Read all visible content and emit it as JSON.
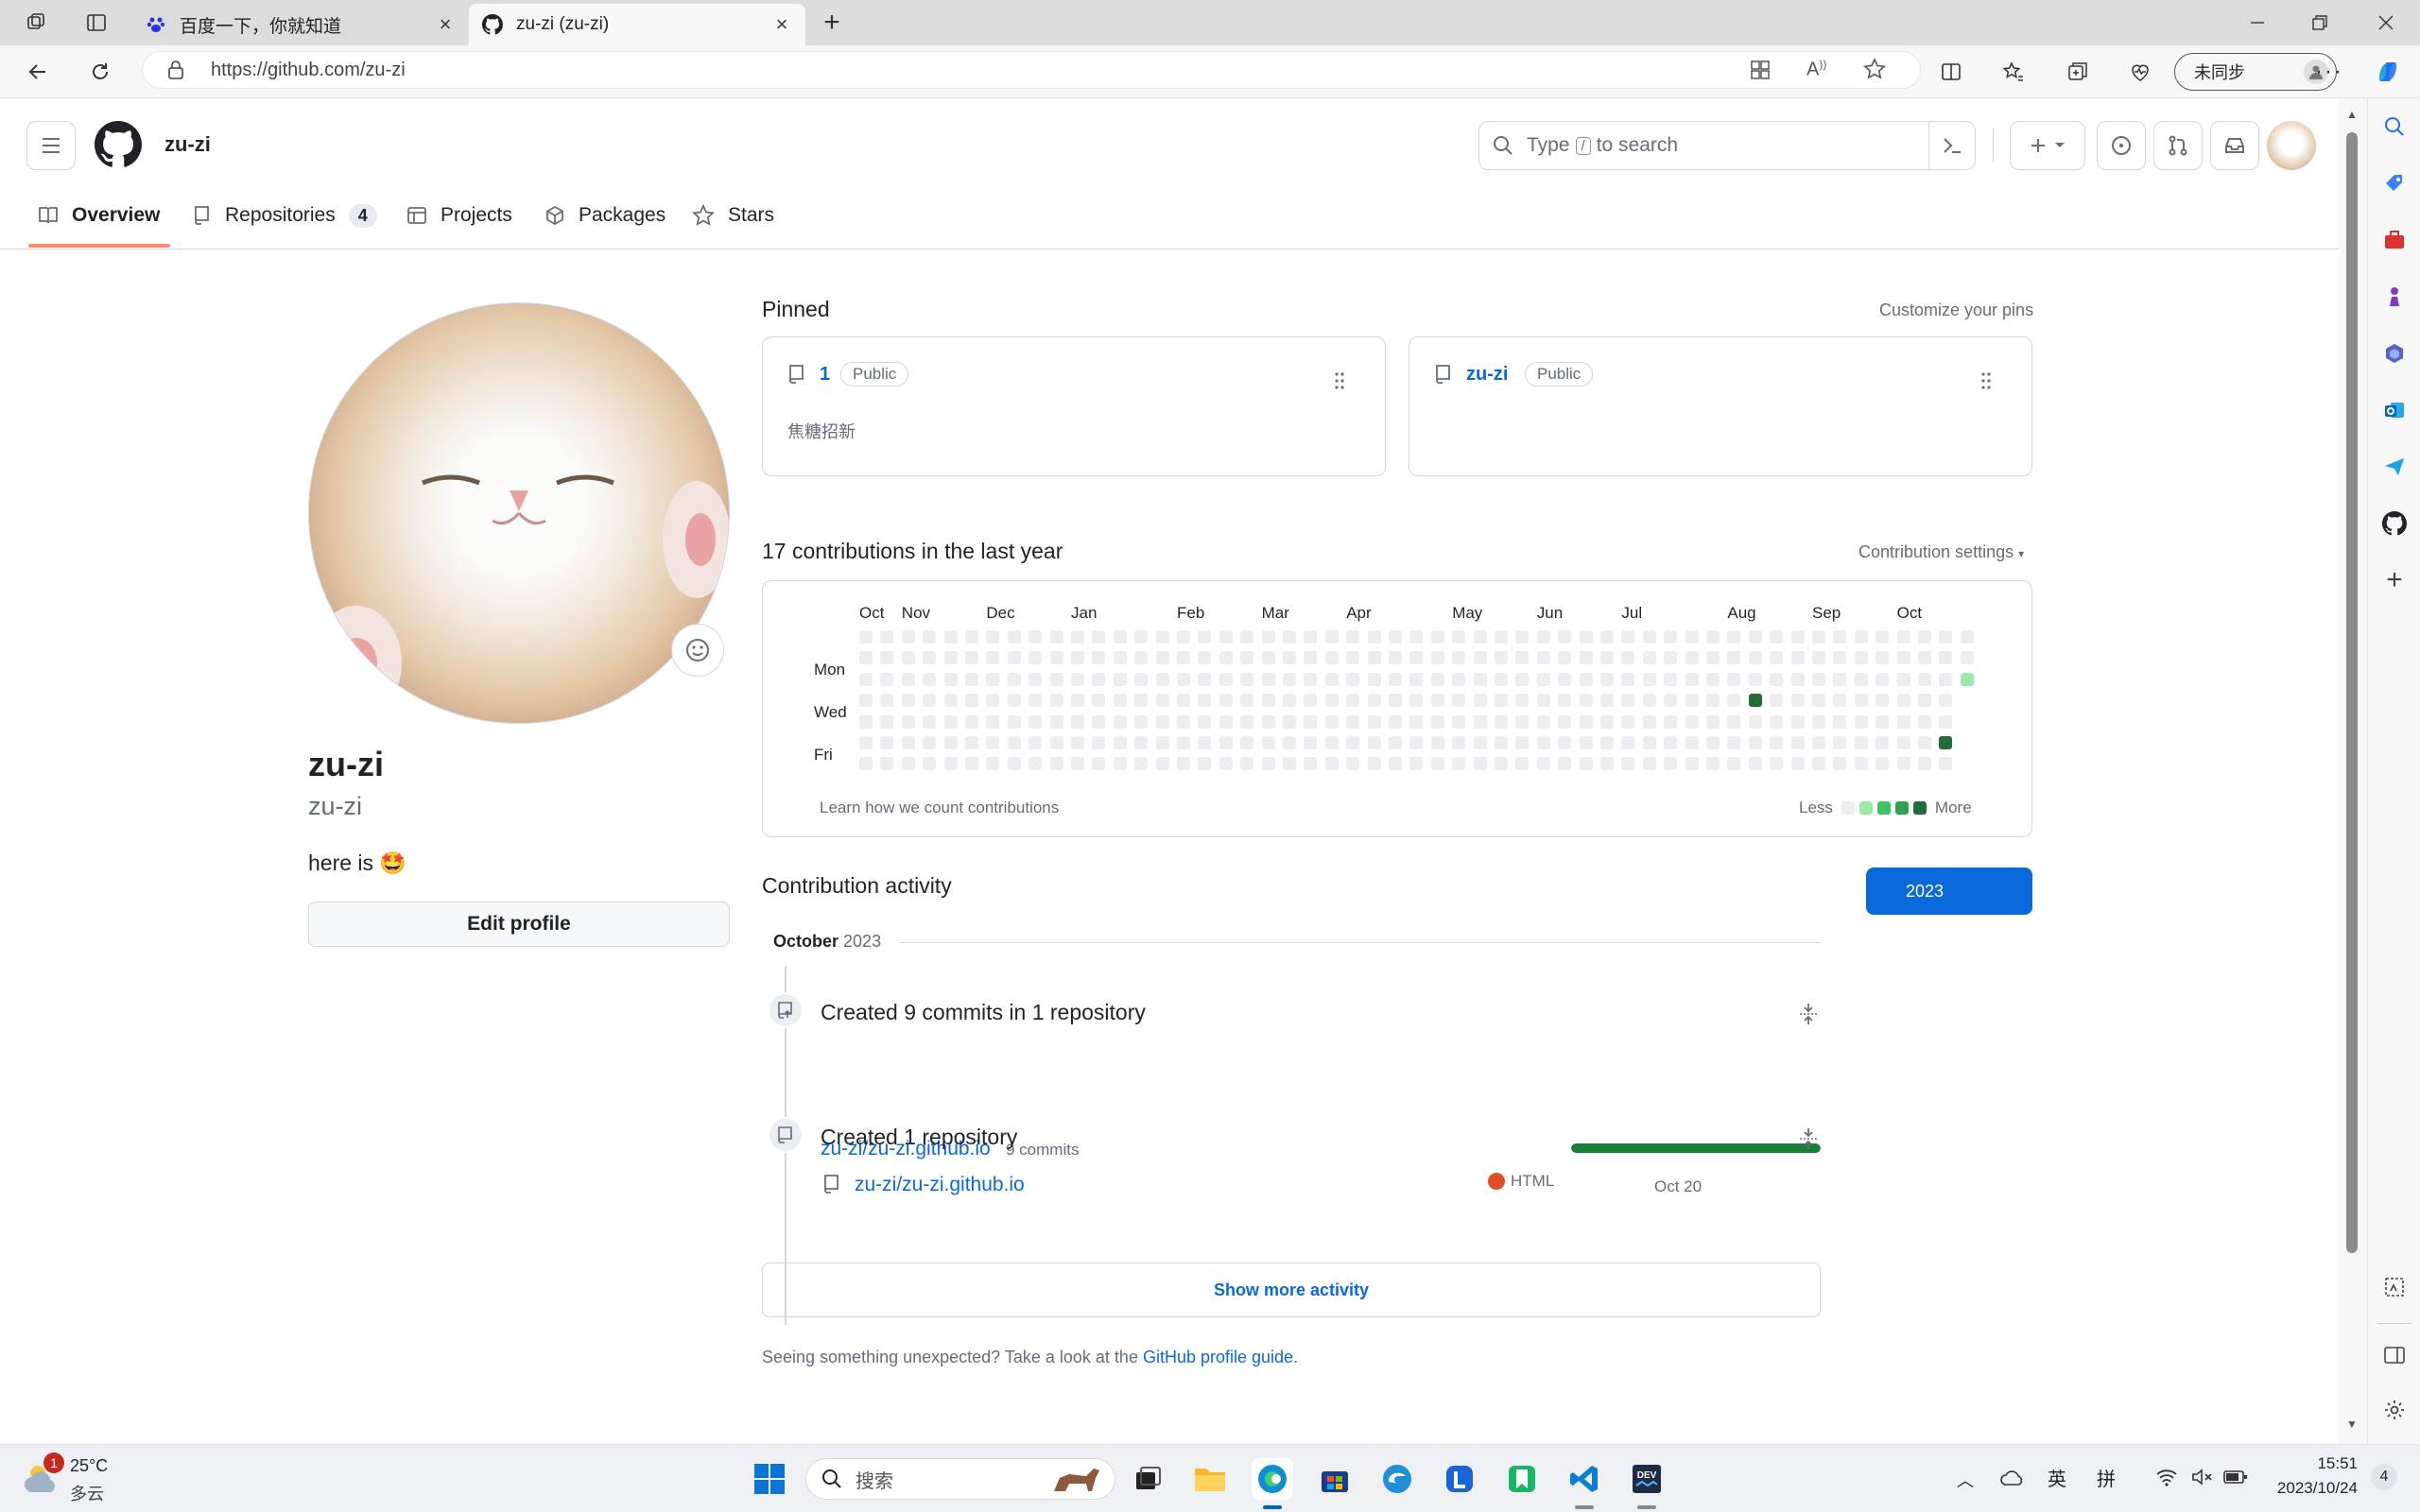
{
  "browser": {
    "tabs": [
      {
        "title": "百度一下，你就知道",
        "active": false
      },
      {
        "title": "zu-zi (zu-zi)",
        "active": true
      }
    ],
    "url": "https://github.com/zu-zi",
    "profile_label": "未同步"
  },
  "header": {
    "username": "zu-zi",
    "search_placeholder_pre": "Type",
    "search_key": "/",
    "search_placeholder_post": "to search"
  },
  "nav": {
    "tabs": [
      {
        "label": "Overview"
      },
      {
        "label": "Repositories",
        "count": "4"
      },
      {
        "label": "Projects"
      },
      {
        "label": "Packages"
      },
      {
        "label": "Stars"
      }
    ]
  },
  "profile": {
    "name": "zu-zi",
    "login": "zu-zi",
    "bio": "here is 🤩",
    "edit_button": "Edit profile"
  },
  "pinned": {
    "title": "Pinned",
    "customize": "Customize your pins",
    "items": [
      {
        "name": "1",
        "visibility": "Public",
        "description": "焦糖招新"
      },
      {
        "name": "zu-zi",
        "visibility": "Public",
        "description": ""
      }
    ]
  },
  "contributions": {
    "title": "17 contributions in the last year",
    "settings": "Contribution settings",
    "months": [
      "Oct",
      "Nov",
      "Dec",
      "Jan",
      "Feb",
      "Mar",
      "Apr",
      "May",
      "Jun",
      "Jul",
      "Aug",
      "Sep",
      "Oct"
    ],
    "day_labels": [
      "Mon",
      "Wed",
      "Fri"
    ],
    "learn": "Learn how we count contributions",
    "less": "Less",
    "more": "More",
    "colors": {
      "empty": "#ebedf0",
      "l1": "#9be9a8",
      "l2": "#40c463",
      "l3": "#30a14e",
      "l4": "#216e39"
    },
    "active_cells": [
      {
        "week": 42,
        "day": 3,
        "level": 4
      },
      {
        "week": 51,
        "day": 5,
        "level": 4
      },
      {
        "week": 52,
        "day": 2,
        "level": 1
      }
    ]
  },
  "activity": {
    "title": "Contribution activity",
    "year": "2023",
    "month": "October",
    "month_year": "2023",
    "items": [
      {
        "title": "Created 9 commits in 1 repository",
        "repo": "zu-zi/zu-zi.github.io",
        "detail": "9 commits",
        "progress": 1.0
      },
      {
        "title": "Created 1 repository",
        "repo": "zu-zi/zu-zi.github.io",
        "language": "HTML",
        "language_color": "#e34c26",
        "date": "Oct 20"
      }
    ],
    "show_more": "Show more activity",
    "footer_text": "Seeing something unexpected? Take a look at the",
    "footer_link": "GitHub profile guide",
    "footer_end": "."
  },
  "taskbar": {
    "weather_temp": "25°C",
    "weather_desc": "多云",
    "weather_badge": "1",
    "search_placeholder": "搜索",
    "ime1": "英",
    "ime2": "拼",
    "time": "15:51",
    "date": "2023/10/24",
    "notification_count": "4"
  }
}
